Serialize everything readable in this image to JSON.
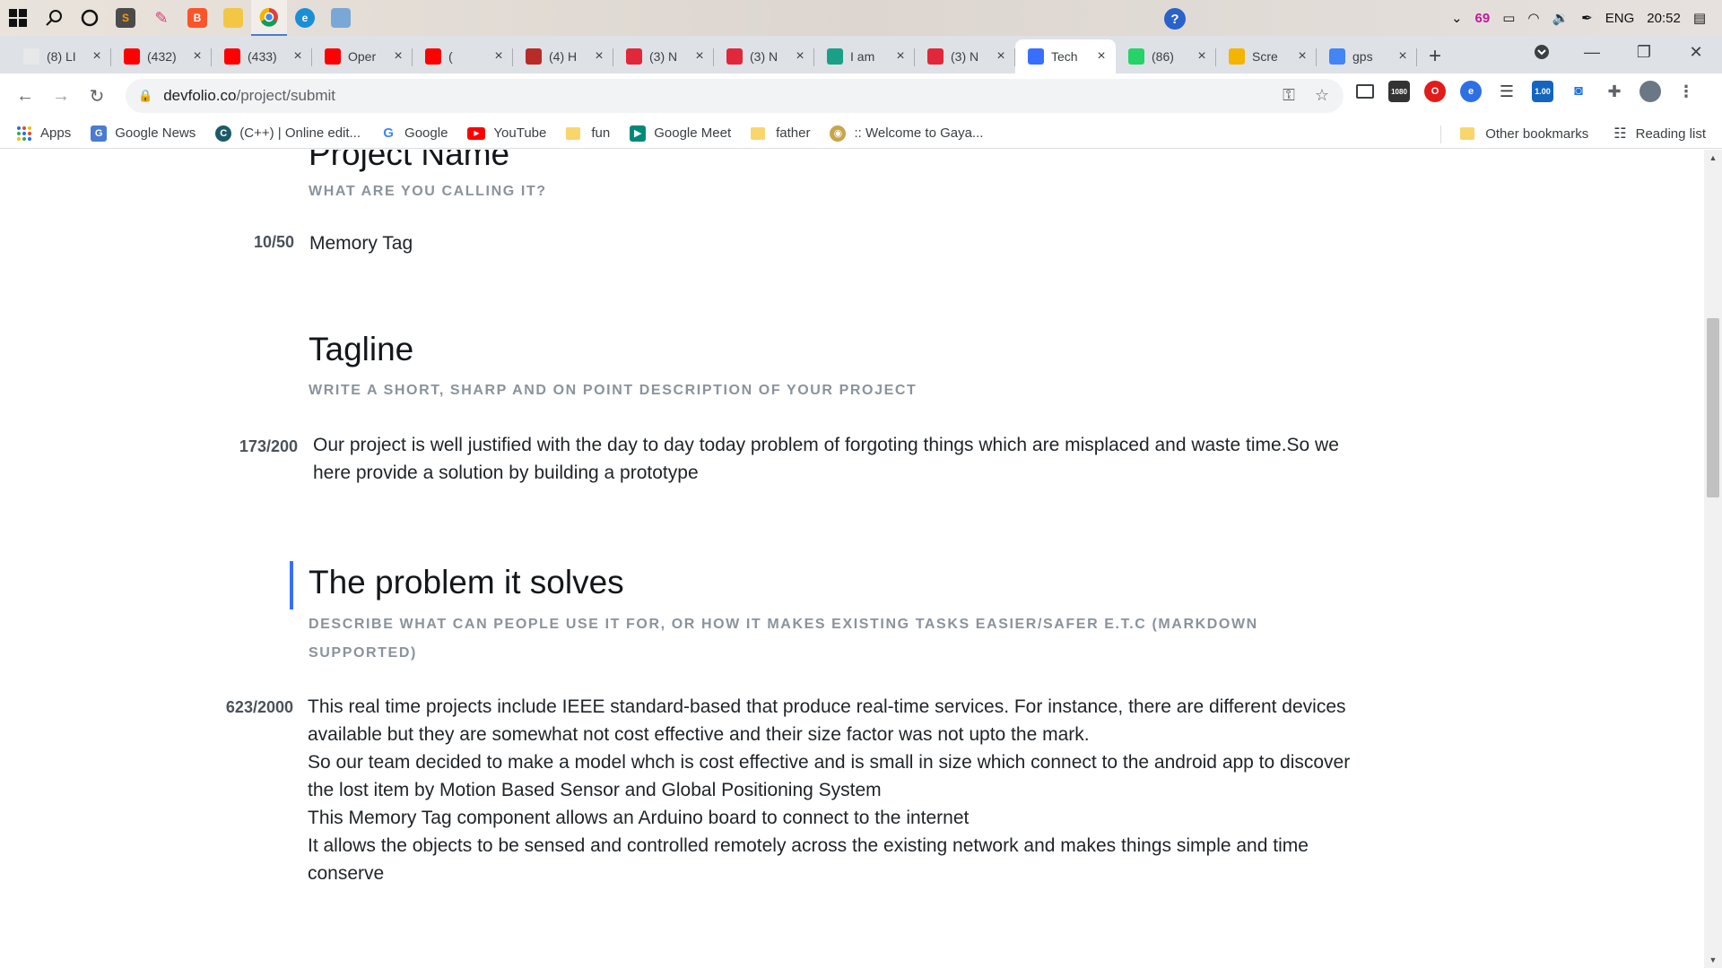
{
  "taskbar": {
    "apps": [
      {
        "icon": "start-icon"
      },
      {
        "icon": "search-icon"
      },
      {
        "icon": "cortana-icon"
      },
      {
        "icon": "sublime-icon"
      },
      {
        "icon": "paint-icon"
      },
      {
        "icon": "brave-icon"
      },
      {
        "icon": "file-explorer-icon"
      },
      {
        "icon": "chrome-icon"
      },
      {
        "icon": "edge-icon"
      },
      {
        "icon": "app-icon"
      }
    ],
    "tray": {
      "notification_count": "69",
      "language": "ENG",
      "time": "20:52"
    }
  },
  "tabs": [
    {
      "label": "(8) LI",
      "color": "#e8e8e8"
    },
    {
      "label": "(432)",
      "color": "#ff0000"
    },
    {
      "label": "(433)",
      "color": "#ff0000"
    },
    {
      "label": "Oper",
      "color": "#ff0000"
    },
    {
      "label": "(",
      "color": "#ff0000"
    },
    {
      "label": "(4) H",
      "color": "#b92b27"
    },
    {
      "label": "(3) N",
      "color": "#e0283a"
    },
    {
      "label": "(3) N",
      "color": "#e0283a"
    },
    {
      "label": "I am",
      "color": "#1aa086"
    },
    {
      "label": "(3) N",
      "color": "#e0283a"
    },
    {
      "label": "Tech",
      "color": "#3770ff",
      "active": true
    },
    {
      "label": "(86)",
      "color": "#25d366"
    },
    {
      "label": "Scre",
      "color": "#f4b400"
    },
    {
      "label": "gps",
      "color": "#4285f4"
    }
  ],
  "toolbar": {
    "url_host": "devfolio.co",
    "url_path": "/project/submit"
  },
  "bookmarks": {
    "items": [
      {
        "label": "Apps"
      },
      {
        "label": "Google News"
      },
      {
        "label": "(C++) | Online edit..."
      },
      {
        "label": "Google"
      },
      {
        "label": "YouTube"
      },
      {
        "label": "fun"
      },
      {
        "label": "Google Meet"
      },
      {
        "label": "father"
      },
      {
        "label": ":: Welcome to Gaya..."
      }
    ],
    "other": "Other bookmarks",
    "reading_list": "Reading list"
  },
  "form": {
    "project_name": {
      "title": "Project Name",
      "subtitle": "WHAT ARE YOU CALLING IT?",
      "count": "10/50",
      "value": "Memory Tag"
    },
    "tagline": {
      "title": "Tagline",
      "subtitle": "WRITE A SHORT, SHARP AND ON POINT DESCRIPTION OF YOUR PROJECT",
      "count": "173/200",
      "value_line1": "Our project is well justified with the day to day today problem of forgoting things which are misplaced and waste time.So we",
      "value_line2": "here  provide a solution by building a prototype"
    },
    "problem": {
      "title": "The problem it solves",
      "subtitle_line1": "DESCRIBE WHAT CAN PEOPLE USE IT FOR, OR HOW IT MAKES EXISTING TASKS EASIER/SAFER E.T.C (MARKDOWN",
      "subtitle_line2": "SUPPORTED)",
      "count": "623/2000",
      "lines": [
        "This real time projects include IEEE standard-based that produce real-time services. For instance, there are different devices",
        "available but they are somewhat not cost effective and their size factor was not upto the mark.",
        "So our team decided to make a model whch is cost effective and is small in size which connect to the android app to discover",
        "the lost item by Motion Based Sensor and Global Positioning System",
        "This Memory Tag  component allows an Arduino board to connect to the internet",
        "It allows the objects to be sensed and controlled remotely across the existing network and makes things simple and time",
        "conserve"
      ]
    }
  },
  "colors": {
    "accent": "#3770ff",
    "subtitle": "#8a939c",
    "text": "#1f2428"
  }
}
